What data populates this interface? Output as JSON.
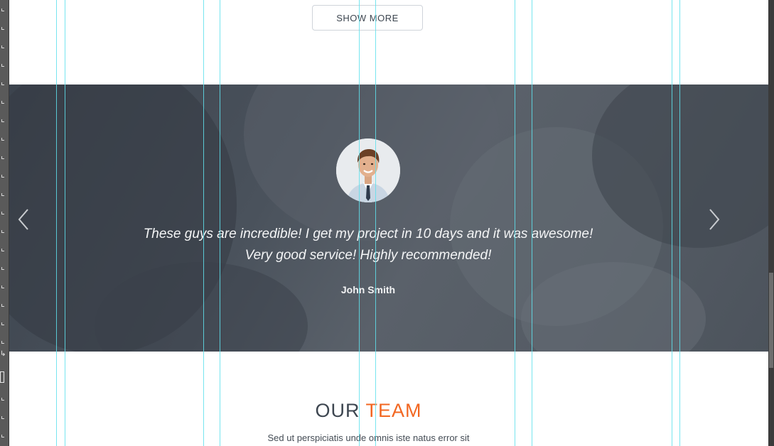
{
  "top_section": {
    "show_more_label": "SHOW MORE"
  },
  "testimonial": {
    "quote_line_1": "These guys are incredible! I get my project in 10 days and it was awesome!",
    "quote_line_2": "Very good service! Highly recommended!",
    "author": "John Smith",
    "prev_icon": "chevron-left-icon",
    "next_icon": "chevron-right-icon"
  },
  "team": {
    "title_main": "OUR",
    "title_accent": "TEAM",
    "subtitle": "Sed ut perspiciatis unde omnis iste natus error sit"
  },
  "colors": {
    "accent": "#f26722",
    "heading": "#3d4650",
    "guide": "#5fe0ec",
    "overlay": "#3c434d"
  }
}
